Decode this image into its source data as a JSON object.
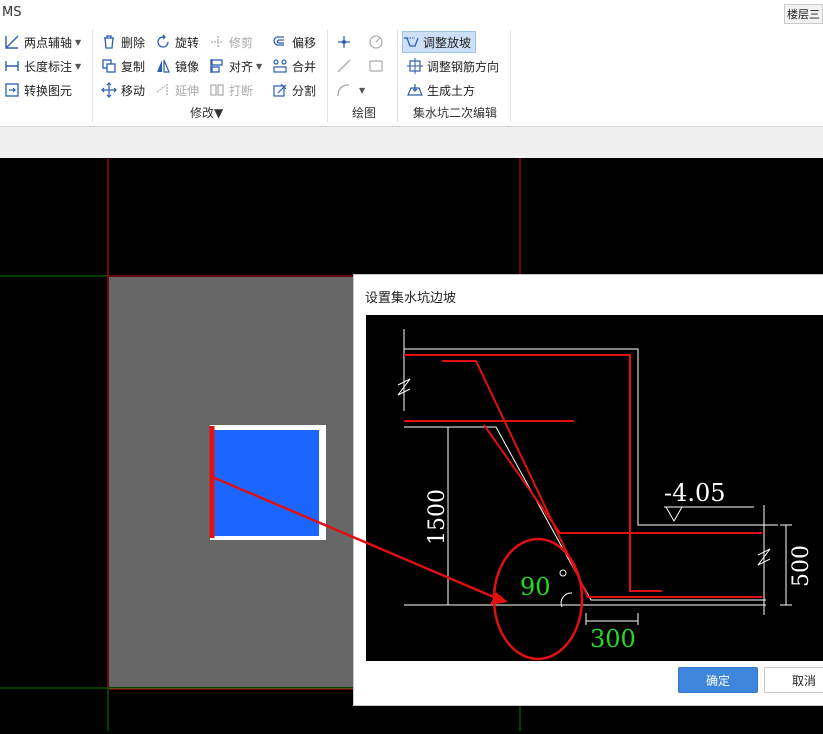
{
  "app": {
    "title": "MS",
    "floor_label": "楼层三"
  },
  "ribbon": {
    "draw_group": [
      {
        "name": "two-point-axis",
        "label": "两点辅轴",
        "dropdown": true
      },
      {
        "name": "length-dimension",
        "label": "长度标注",
        "dropdown": true
      },
      {
        "name": "convert-element",
        "label": "转换图元",
        "dropdown": false
      }
    ],
    "modify_group": {
      "label": "修改",
      "items": [
        {
          "name": "delete",
          "label": "删除",
          "enabled": true
        },
        {
          "name": "rotate",
          "label": "旋转",
          "enabled": true
        },
        {
          "name": "trim",
          "label": "修剪",
          "enabled": false
        },
        {
          "name": "offset",
          "label": "偏移",
          "enabled": true
        },
        {
          "name": "copy",
          "label": "复制",
          "enabled": true
        },
        {
          "name": "mirror",
          "label": "镜像",
          "enabled": true
        },
        {
          "name": "align",
          "label": "对齐",
          "enabled": true,
          "dropdown": true
        },
        {
          "name": "merge",
          "label": "合并",
          "enabled": true
        },
        {
          "name": "move",
          "label": "移动",
          "enabled": true
        },
        {
          "name": "extend",
          "label": "延伸",
          "enabled": false
        },
        {
          "name": "break",
          "label": "打断",
          "enabled": false
        },
        {
          "name": "split",
          "label": "分割",
          "enabled": true
        }
      ]
    },
    "drawing_group": {
      "label": "绘图"
    },
    "sump_group": {
      "label": "集水坑二次编辑",
      "items": [
        {
          "name": "adjust-slope",
          "label": "调整放坡",
          "active": true
        },
        {
          "name": "adjust-rebar-direction",
          "label": "调整钢筋方向",
          "active": false
        },
        {
          "name": "generate-earthwork",
          "label": "生成土方",
          "active": false
        }
      ]
    }
  },
  "dialog": {
    "title": "设置集水坑边坡",
    "diagram": {
      "elevation": "-4.05",
      "depth": "1500",
      "thickness": "500",
      "angle": "90",
      "width": "300"
    },
    "ok_label": "确定",
    "cancel_label": "取消"
  },
  "colors": {
    "accent": "#3d86db",
    "sump_fill": "#1a66ff",
    "slab_fill": "#676767",
    "rebar": "#e01010",
    "dim_green": "#22dd22"
  }
}
